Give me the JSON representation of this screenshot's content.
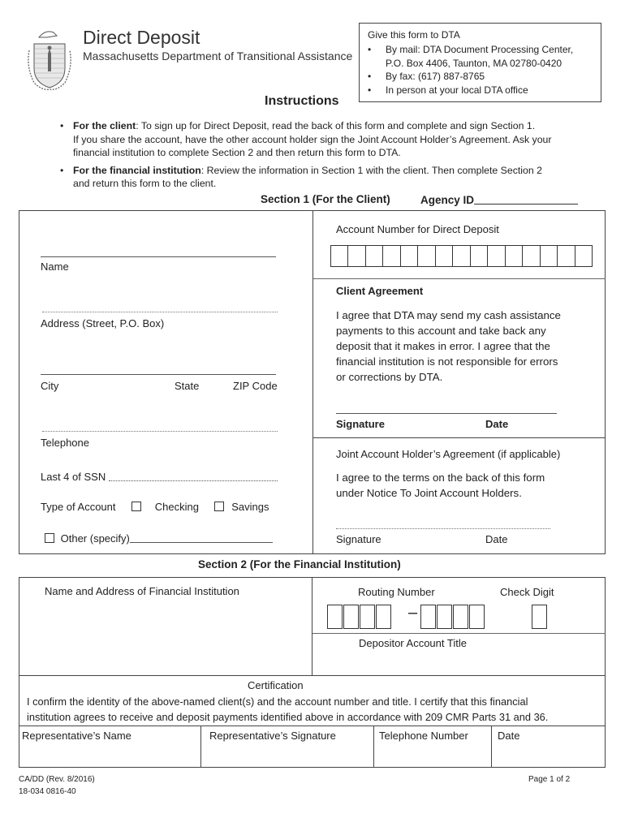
{
  "header": {
    "title": "Direct Deposit",
    "subtitle": "Massachusetts Department of Transitional Assistance",
    "seal_icon": "massachusetts-seal-icon"
  },
  "submit_box": {
    "heading": "Give this form to DTA",
    "items": [
      "By mail: DTA Document Processing Center,",
      "P.O. Box 4406, Taunton, MA 02780-0420",
      "By fax: (617) 887-8765",
      "In person at your local DTA office"
    ]
  },
  "instructions": {
    "title": "Instructions",
    "client_label": "For the client",
    "client_text_1": ": To sign up for Direct Deposit, read the back of this form and complete and sign Section 1.",
    "client_text_2": "If you share the account, have the other account holder sign the Joint Account Holder’s Agreement.  Ask your",
    "client_text_3": "financial institution to complete Section 2 and then return this form to DTA.",
    "fi_label": "For the financial institution",
    "fi_text_1": ":  Review the information in Section 1 with the client.  Then complete Section 2",
    "fi_text_2": "and return this form to the client."
  },
  "section1": {
    "title": "Section 1 (For the Client)",
    "agency_id_label": "Agency ID",
    "name_label": "Name",
    "address_label": "Address (Street, P.O. Box)",
    "city_label": "City",
    "state_label": "State",
    "zip_label": "ZIP Code",
    "telephone_label": "Telephone",
    "ssn_label": "Last 4 of SSN",
    "account_type_label": "Type of Account",
    "checking_label": "Checking",
    "savings_label": "Savings",
    "other_label": "Other (specify)",
    "account_number_label": "Account Number for Direct Deposit",
    "account_number_cells": 15,
    "client_agreement_title": "Client Agreement",
    "client_agreement_lines": [
      "I agree that DTA may send my cash assistance",
      "payments to this account and take back any",
      "deposit that it makes in error.  I agree that the",
      "financial institution is not responsible for errors",
      "or corrections by DTA."
    ],
    "signature_label": "Signature",
    "date_label": "Date",
    "joint_title": "Joint Account Holder’s Agreement (if applicable)",
    "joint_lines": [
      "I agree to the terms on the back of this form",
      "under Notice To Joint Account Holders."
    ],
    "joint_signature_label": "Signature",
    "joint_date_label": "Date"
  },
  "section2": {
    "title": "Section 2 (For the Financial Institution)",
    "fi_name_label": "Name and Address of Financial Institution",
    "routing_label": "Routing Number",
    "check_digit_label": "Check Digit",
    "routing_separator": "–",
    "depositor_title_label": "Depositor Account Title",
    "certification_title": "Certification",
    "certification_lines": [
      "I confirm the identity of the above-named client(s) and the account number and title.  I certify that this financial",
      "institution agrees to receive and deposit payments identified above in accordance with 209 CMR Parts 31 and 36."
    ],
    "rep_name_label": "Representative’s Name",
    "rep_signature_label": "Representative’s Signature",
    "telephone_label": "Telephone Number",
    "date_label": "Date"
  },
  "footer": {
    "form_id": "CA/DD (Rev. 8/2016)",
    "form_code": "18-034 0816-40",
    "page": "Page 1 of 2"
  }
}
